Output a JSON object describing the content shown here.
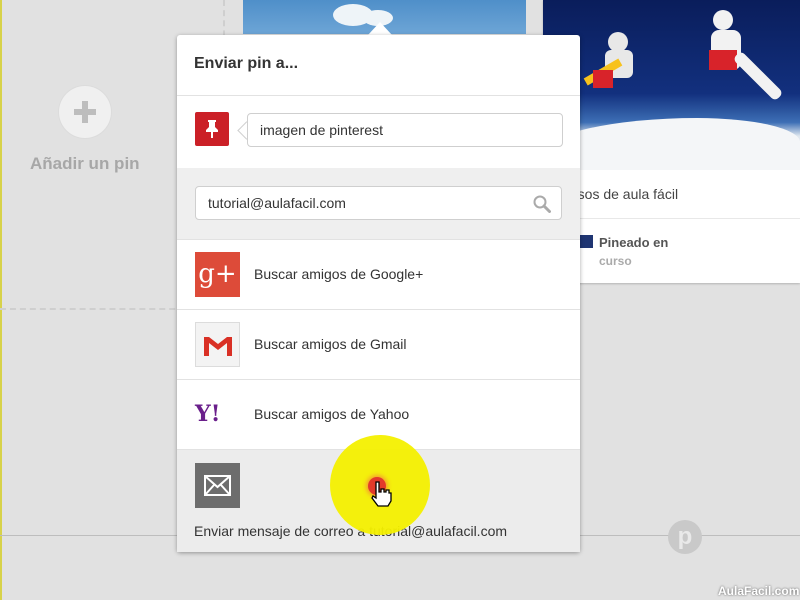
{
  "background": {
    "add_pin_label": "Añadir un pin",
    "right_card": {
      "description": "rsos de aula fácil",
      "pinned_label": "Pineado en",
      "board": "curso"
    },
    "watermark": "AulaFacil.com"
  },
  "popup": {
    "title": "Enviar pin a...",
    "message_input_value": "imagen de pinterest",
    "search_input_value": "tutorial@aulafacil.com",
    "options": [
      {
        "label": "Buscar amigos de Google+",
        "icon": "google-plus-icon"
      },
      {
        "label": "Buscar amigos de Gmail",
        "icon": "gmail-icon"
      },
      {
        "label": "Buscar amigos de Yahoo",
        "icon": "yahoo-icon"
      }
    ],
    "email_option_label": "Enviar mensaje de correo a tutorial@aulafacil.com",
    "icons": {
      "google_plus": "g+",
      "yahoo": "Y!"
    }
  },
  "colors": {
    "pinterest_red": "#cb2027",
    "google_plus_red": "#dd4b39",
    "cursor_highlight": "#f4f000"
  }
}
